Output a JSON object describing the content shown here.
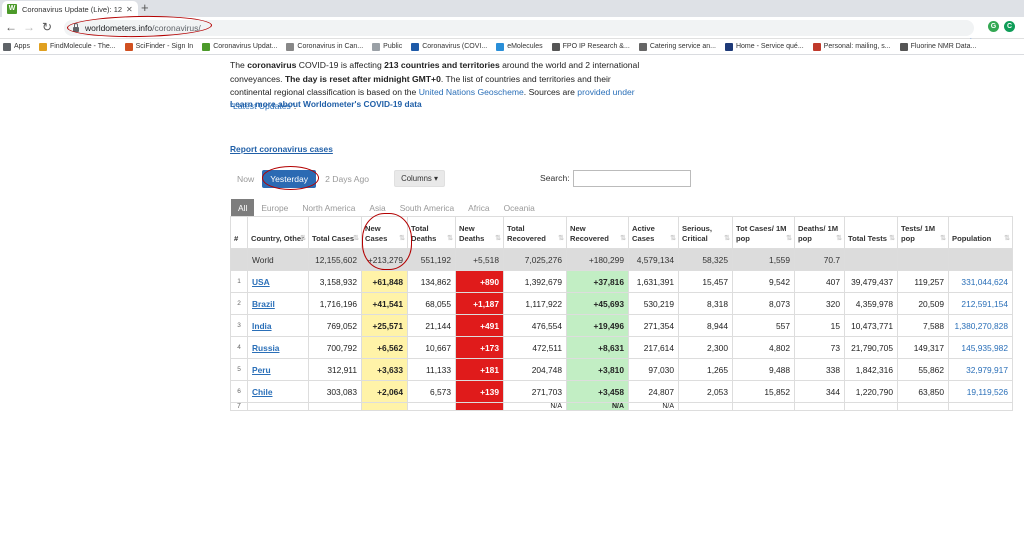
{
  "browser": {
    "tab_title": "Coronavirus Update (Live): 12,15",
    "tab_favicon": "W",
    "url_host": "worldometers.info",
    "url_path": "/coronavirus/",
    "profile_letter": "C",
    "bookmarks": [
      {
        "label": "Apps",
        "icon": "apps-grid",
        "color": "#5f6368"
      },
      {
        "label": "FindMolecule - The...",
        "icon": "findmolecule",
        "color": "#e0a020"
      },
      {
        "label": "SciFinder - Sign In",
        "icon": "scifinder",
        "color": "#d05020"
      },
      {
        "label": "Coronavirus Updat...",
        "icon": "worldometers",
        "color": "#4c9a2a"
      },
      {
        "label": "Coronavirus in Can...",
        "icon": "canada-news",
        "color": "#888888"
      },
      {
        "label": "Public",
        "icon": "public-folder",
        "color": "#9aa0a6"
      },
      {
        "label": "Coronavirus (COVI...",
        "icon": "gov-site",
        "color": "#1e5aa8"
      },
      {
        "label": "eMolecules",
        "icon": "emolecules",
        "color": "#2a8fd8"
      },
      {
        "label": "FPO IP Research &...",
        "icon": "fpo",
        "color": "#555555"
      },
      {
        "label": "Catering service an...",
        "icon": "catering",
        "color": "#666666"
      },
      {
        "label": "Home - Service qué...",
        "icon": "quebec",
        "color": "#1e3a78"
      },
      {
        "label": "Personal: mailing, s...",
        "icon": "personal",
        "color": "#c0392b"
      },
      {
        "label": "Fluorine NMR Data...",
        "icon": "fluorine",
        "color": "#555555"
      }
    ]
  },
  "intro": {
    "s1a": "The ",
    "s1b": "coronavirus",
    "s1c": " COVID-19 is affecting ",
    "s1d": "213 countries and territories",
    "s1e": " around the world and 2 international conveyances. ",
    "s2a": "The day is reset after midnight GMT+0",
    "s2b": ". The list of countries and territories and their continental regional classification is based on the ",
    "s2c": "United Nations Geoscheme",
    "s2d": ". Sources are ",
    "s2e": "provided under \"Latest Updates\"",
    "s2f": ".",
    "learn_more": "Learn more about Worldometer's COVID-19 data"
  },
  "report_link": "Report coronavirus cases",
  "day_tabs": {
    "now": "Now",
    "yesterday": "Yesterday",
    "two_days": "2 Days Ago"
  },
  "columns_button": "Columns ▾",
  "search": {
    "label": "Search:",
    "value": ""
  },
  "regions": [
    "All",
    "Europe",
    "North America",
    "Asia",
    "South America",
    "Africa",
    "Oceania"
  ],
  "table": {
    "headers": {
      "num": "#",
      "country": "Country, Other",
      "total_cases": "Total Cases",
      "new_cases": "New Cases",
      "total_deaths": "Total Deaths",
      "new_deaths": "New Deaths",
      "total_recovered": "Total Recovered",
      "new_recovered": "New Recovered",
      "active": "Active Cases",
      "serious": "Serious, Critical",
      "cases_per_m": "Tot Cases/ 1M pop",
      "deaths_per_m": "Deaths/ 1M pop",
      "total_tests": "Total Tests",
      "tests_per_m": "Tests/ 1M pop",
      "population": "Population"
    },
    "world": {
      "country": "World",
      "total_cases": "12,155,602",
      "new_cases": "+213,279",
      "total_deaths": "551,192",
      "new_deaths": "+5,518",
      "total_recovered": "7,025,276",
      "new_recovered": "+180,299",
      "active": "4,579,134",
      "serious": "58,325",
      "cases_per_m": "1,559",
      "deaths_per_m": "70.7"
    },
    "rows": [
      {
        "num": "1",
        "country": "USA",
        "total_cases": "3,158,932",
        "new_cases": "+61,848",
        "total_deaths": "134,862",
        "new_deaths": "+890",
        "total_recovered": "1,392,679",
        "new_recovered": "+37,816",
        "active": "1,631,391",
        "serious": "15,457",
        "cases_per_m": "9,542",
        "deaths_per_m": "407",
        "total_tests": "39,479,437",
        "tests_per_m": "119,257",
        "population": "331,044,624"
      },
      {
        "num": "2",
        "country": "Brazil",
        "total_cases": "1,716,196",
        "new_cases": "+41,541",
        "total_deaths": "68,055",
        "new_deaths": "+1,187",
        "total_recovered": "1,117,922",
        "new_recovered": "+45,693",
        "active": "530,219",
        "serious": "8,318",
        "cases_per_m": "8,073",
        "deaths_per_m": "320",
        "total_tests": "4,359,978",
        "tests_per_m": "20,509",
        "population": "212,591,154"
      },
      {
        "num": "3",
        "country": "India",
        "total_cases": "769,052",
        "new_cases": "+25,571",
        "total_deaths": "21,144",
        "new_deaths": "+491",
        "total_recovered": "476,554",
        "new_recovered": "+19,496",
        "active": "271,354",
        "serious": "8,944",
        "cases_per_m": "557",
        "deaths_per_m": "15",
        "total_tests": "10,473,771",
        "tests_per_m": "7,588",
        "population": "1,380,270,828"
      },
      {
        "num": "4",
        "country": "Russia",
        "total_cases": "700,792",
        "new_cases": "+6,562",
        "total_deaths": "10,667",
        "new_deaths": "+173",
        "total_recovered": "472,511",
        "new_recovered": "+8,631",
        "active": "217,614",
        "serious": "2,300",
        "cases_per_m": "4,802",
        "deaths_per_m": "73",
        "total_tests": "21,790,705",
        "tests_per_m": "149,317",
        "population": "145,935,982"
      },
      {
        "num": "5",
        "country": "Peru",
        "total_cases": "312,911",
        "new_cases": "+3,633",
        "total_deaths": "11,133",
        "new_deaths": "+181",
        "total_recovered": "204,748",
        "new_recovered": "+3,810",
        "active": "97,030",
        "serious": "1,265",
        "cases_per_m": "9,488",
        "deaths_per_m": "338",
        "total_tests": "1,842,316",
        "tests_per_m": "55,862",
        "population": "32,979,917"
      },
      {
        "num": "6",
        "country": "Chile",
        "total_cases": "303,083",
        "new_cases": "+2,064",
        "total_deaths": "6,573",
        "new_deaths": "+139",
        "total_recovered": "271,703",
        "new_recovered": "+3,458",
        "active": "24,807",
        "serious": "2,053",
        "cases_per_m": "15,852",
        "deaths_per_m": "344",
        "total_tests": "1,220,790",
        "tests_per_m": "63,850",
        "population": "19,119,526"
      }
    ],
    "partial_row": {
      "num": "7",
      "total_recovered": "N/A",
      "new_recovered": "N/A",
      "active": "N/A"
    }
  },
  "colors": {
    "accent": "#2b6ab3",
    "new_cases_bg": "#fff3a8",
    "new_deaths_bg": "#e01b1b",
    "new_recovered_bg": "#c2eec4",
    "annotation_red": "#b30000"
  }
}
